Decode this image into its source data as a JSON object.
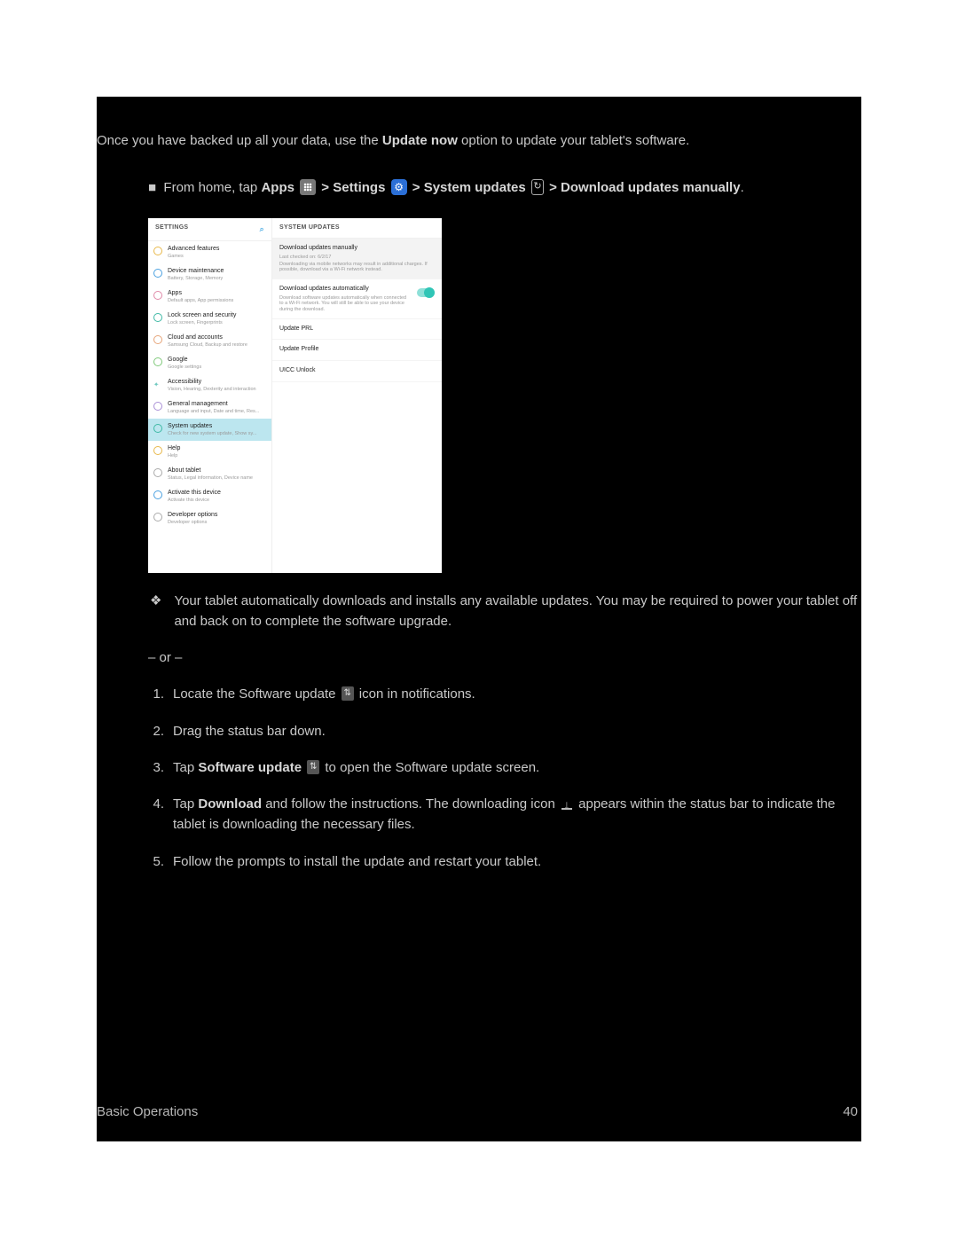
{
  "intro": {
    "prefix": "Once you have backed up all your data, use the ",
    "bold": "Update now",
    "suffix": " option to update your tablet's software."
  },
  "navpath": {
    "prefix": "From home, tap ",
    "apps": "Apps",
    "settings": "Settings",
    "sysupdates": "System updates",
    "download": "Download updates manually",
    "sep": " > ",
    "period": "."
  },
  "screenshot": {
    "left_header": "SETTINGS",
    "right_header": "SYSTEM UPDATES",
    "items": [
      {
        "title": "Advanced features",
        "sub": "Games"
      },
      {
        "title": "Device maintenance",
        "sub": "Battery, Storage, Memory"
      },
      {
        "title": "Apps",
        "sub": "Default apps, App permissions"
      },
      {
        "title": "Lock screen and security",
        "sub": "Lock screen, Fingerprints"
      },
      {
        "title": "Cloud and accounts",
        "sub": "Samsung Cloud, Backup and restore"
      },
      {
        "title": "Google",
        "sub": "Google settings"
      },
      {
        "title": "Accessibility",
        "sub": "Vision, Hearing, Dexterity and interaction"
      },
      {
        "title": "General management",
        "sub": "Language and input, Date and time, Res..."
      },
      {
        "title": "System updates",
        "sub": "Check for new system update, Show sy..."
      },
      {
        "title": "Help",
        "sub": "Help"
      },
      {
        "title": "About tablet",
        "sub": "Status, Legal information, Device name"
      },
      {
        "title": "Activate this device",
        "sub": "Activate this device"
      },
      {
        "title": "Developer options",
        "sub": "Developer options"
      }
    ],
    "right_items": {
      "manual_title": "Download updates manually",
      "manual_sub1": "Last checked on: 6/2/17",
      "manual_sub2": "Downloading via mobile networks may result in additional charges. If possible, download via a Wi-Fi network instead.",
      "auto_title": "Download updates automatically",
      "auto_sub": "Download software updates automatically when connected to a Wi-Fi network. You will still be able to use your device during the download.",
      "prl": "Update PRL",
      "profile": "Update Profile",
      "uicc": "UICC Unlock"
    }
  },
  "result_bullet": "Your tablet automatically downloads and installs any available updates. You may be required to power your tablet off and back on to complete the software upgrade.",
  "or_text": "– or –",
  "steps": {
    "s1a": "Locate the Software update ",
    "s1b": " icon in notifications.",
    "s2": "Drag the status bar down.",
    "s3a": "Tap ",
    "s3bold": "Software update",
    "s3b": " to open the Software update screen.",
    "s4a": "Tap ",
    "s4bold": "Download",
    "s4b": " and follow the instructions. The downloading icon ",
    "s4c": " appears within the status bar to indicate the tablet is downloading the necessary files.",
    "s5": "Follow the prompts to install the update and restart your tablet."
  },
  "footer": {
    "section": "Basic Operations",
    "page": "40"
  }
}
